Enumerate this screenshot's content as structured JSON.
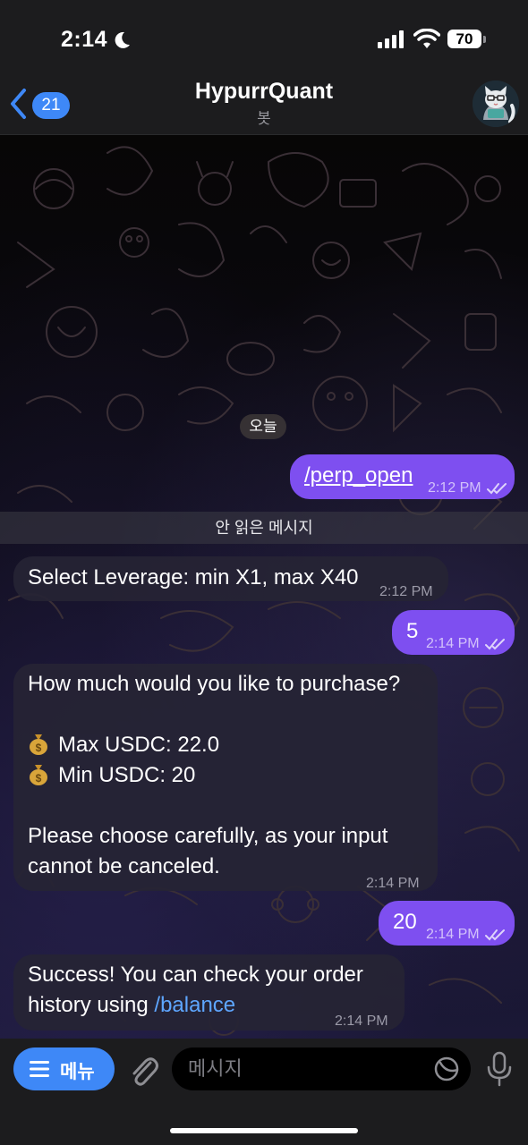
{
  "status_bar": {
    "time": "2:14",
    "battery": "70"
  },
  "header": {
    "back_count": "21",
    "title": "HypurrQuant",
    "subtitle": "봇",
    "avatar_icon": "cat-avatar-icon"
  },
  "chat": {
    "date_chip": "오늘",
    "unread_label": "안 읽은 메시지",
    "messages": [
      {
        "dir": "out",
        "text": "/perp_open",
        "time": "2:12 PM",
        "read": true
      },
      {
        "dir": "in",
        "text": "Select Leverage: min X1, max X40",
        "time": "2:12 PM"
      },
      {
        "dir": "out",
        "text": "5",
        "time": "2:14 PM",
        "read": true
      },
      {
        "dir": "in",
        "lines": [
          "How much would you like to purchase?",
          "",
          "💰 Max USDC: 22.0",
          "💰 Min USDC: 20",
          "",
          "Please choose carefully, as your input",
          "cannot be canceled."
        ],
        "time": "2:14 PM"
      },
      {
        "dir": "out",
        "text": "20",
        "time": "2:14 PM",
        "read": true
      },
      {
        "dir": "in",
        "line1": "Success! You can check your order",
        "line2_prefix": "history using ",
        "link": "/balance",
        "time": "2:14 PM"
      }
    ]
  },
  "input_bar": {
    "menu_label": "메뉴",
    "placeholder": "메시지"
  },
  "colors": {
    "accent": "#3e88f7",
    "outgoing_bubble": "#7e4ff0",
    "incoming_bubble": "#262434",
    "link": "#5ea6ff"
  }
}
